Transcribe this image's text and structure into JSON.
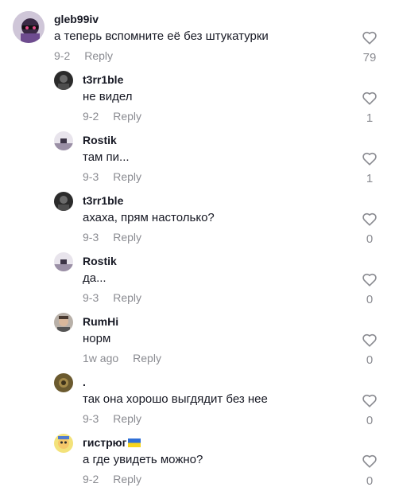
{
  "comments": [
    {
      "username": "gleb99iv",
      "text": "а теперь вспомните её без штукатурки",
      "date": "9-2",
      "reply": "Reply",
      "likes": "79",
      "avatar": "avatar-cartoon"
    },
    {
      "username": "t3rr1ble",
      "text": "не видел",
      "date": "9-2",
      "reply": "Reply",
      "likes": "1",
      "avatar": "avatar-dark"
    },
    {
      "username": "Rostik",
      "text": "там пи...",
      "date": "9-3",
      "reply": "Reply",
      "likes": "1",
      "avatar": "avatar-landscape"
    },
    {
      "username": "t3rr1ble",
      "text": "ахаха, прям настолько?",
      "date": "9-3",
      "reply": "Reply",
      "likes": "0",
      "avatar": "avatar-dark"
    },
    {
      "username": "Rostik",
      "text": "да...",
      "date": "9-3",
      "reply": "Reply",
      "likes": "0",
      "avatar": "avatar-landscape"
    },
    {
      "username": "RumHi",
      "text": "норм",
      "date": "1w ago",
      "reply": "Reply",
      "likes": "0",
      "avatar": "avatar-face"
    },
    {
      "username": ".",
      "text": "так она хорошо выгдядит без нее",
      "date": "9-3",
      "reply": "Reply",
      "likes": "0",
      "avatar": "avatar-olive"
    },
    {
      "username": "гистрюг",
      "text": "а где увидеть можно?",
      "date": "9-2",
      "reply": "Reply",
      "likes": "0",
      "avatar": "avatar-cartoon-yellow",
      "flag": "ukraine-flag"
    }
  ],
  "colors": {
    "text": "#161823",
    "meta": "#8a8b91",
    "icon": "#8a8b91"
  }
}
